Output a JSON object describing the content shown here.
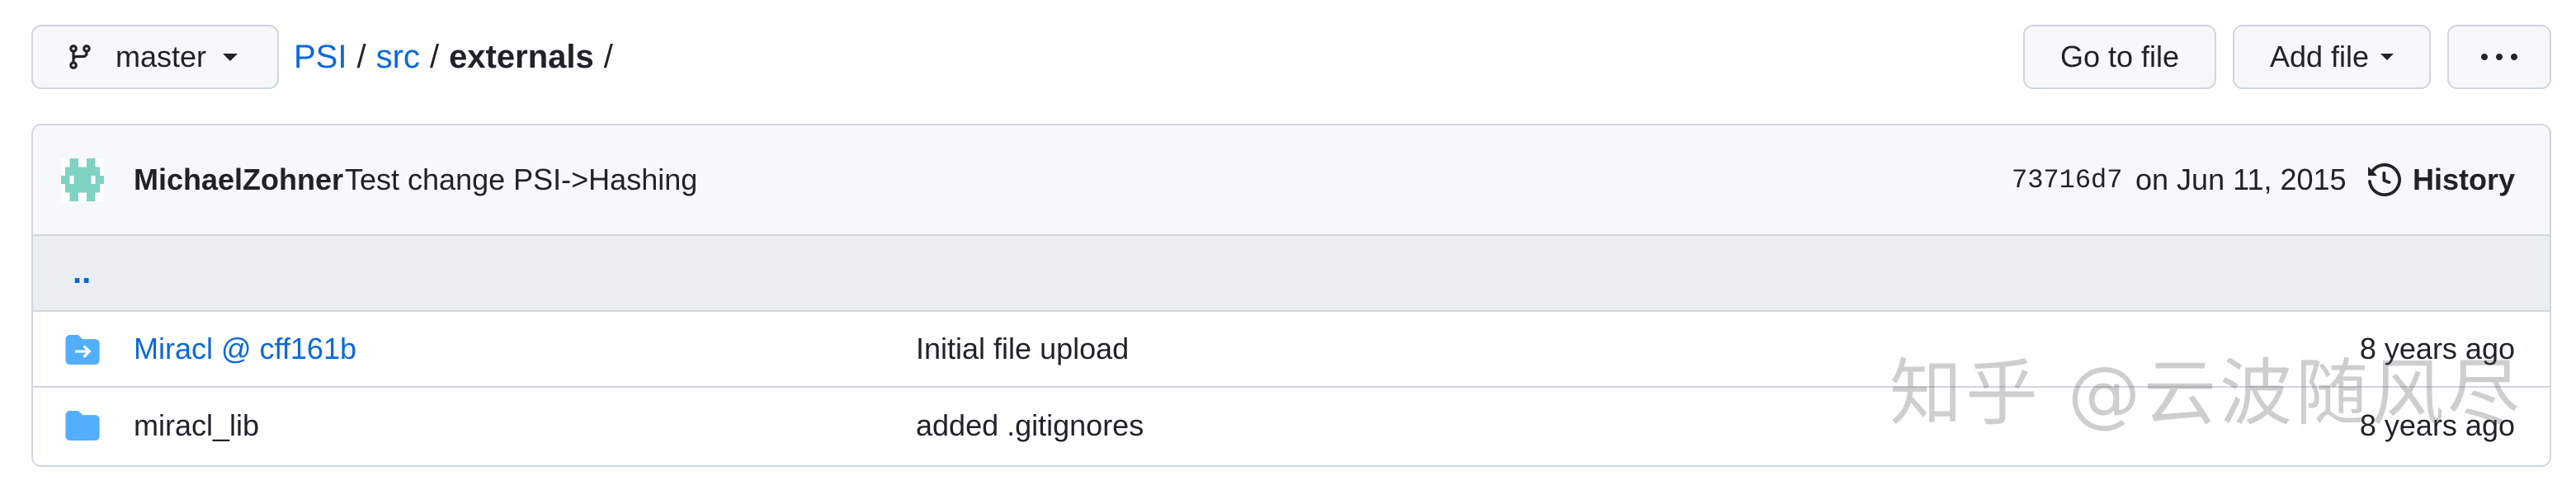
{
  "toolbar": {
    "branch_label": "master",
    "goto_file_label": "Go to file",
    "add_file_label": "Add file",
    "more_icon": "kebab-horizontal-icon"
  },
  "breadcrumb": {
    "repo": "PSI",
    "sep1": "/",
    "folder": "src",
    "sep2": "/",
    "current": "externals",
    "sep3": "/"
  },
  "commit": {
    "author": "MichaelZohner",
    "message": "Test change PSI->Hashing",
    "sha": "73716d7",
    "date": "on Jun 11, 2015",
    "history_label": "History"
  },
  "parent_dir": "..",
  "files": [
    {
      "name": "Miracl @ cff161b",
      "message": "Initial file upload",
      "age": "8 years ago",
      "kind": "submodule"
    },
    {
      "name": "miracl_lib",
      "message": "added .gitignores",
      "age": "8 years ago",
      "kind": "directory"
    }
  ],
  "watermark": "知乎 @云波随风尽",
  "colors": {
    "link": "#0969da",
    "folder": "#54aeff",
    "border": "#d0d7de",
    "header_bg": "#f6f8fa"
  }
}
